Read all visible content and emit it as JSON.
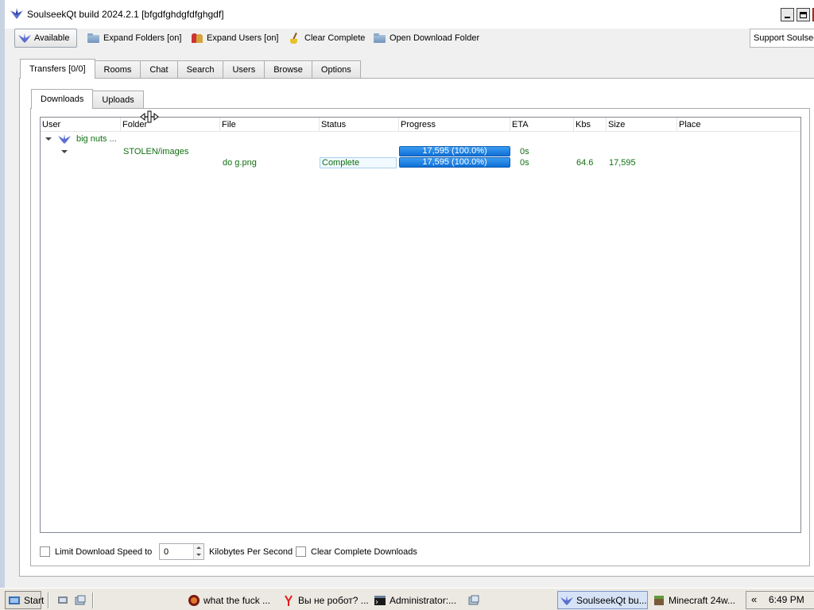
{
  "window": {
    "title": "SoulseekQt build 2024.2.1 [bfgdfghdgfdfghgdf]"
  },
  "toolbar": {
    "available": "Available",
    "expand_folders": "Expand Folders [on]",
    "expand_users": "Expand Users [on]",
    "clear_complete": "Clear Complete",
    "open_download_folder": "Open Download Folder",
    "support": "Support Soulseek"
  },
  "main_tabs": [
    "Transfers [0/0]",
    "Rooms",
    "Chat",
    "Search",
    "Users",
    "Browse",
    "Options"
  ],
  "active_main_tab": "Transfers [0/0]",
  "sub_tabs": [
    "Downloads",
    "Uploads"
  ],
  "active_sub_tab": "Downloads",
  "table": {
    "columns": [
      "User",
      "Folder",
      "File",
      "Status",
      "Progress",
      "ETA",
      "Kbs",
      "Size",
      "Place"
    ],
    "user_row": {
      "user": "big nuts ..."
    },
    "folder_row": {
      "folder": "STOLEN/images",
      "progress": "17,595 (100.0%)",
      "progress_fraction": 1.0,
      "eta": "0s"
    },
    "file_row": {
      "file": "do g.png",
      "status": "Complete",
      "progress": "17,595 (100.0%)",
      "progress_fraction": 1.0,
      "eta": "0s",
      "kbs": "64.6",
      "size": "17,595",
      "place": ""
    }
  },
  "bottom": {
    "limit_label": "Limit Download Speed to",
    "limit_checked": false,
    "limit_value": "0",
    "units_label": "Kilobytes Per Second",
    "clear_complete_label": "Clear Complete Downloads",
    "clear_complete_checked": false
  },
  "taskbar": {
    "start": "Start",
    "tasks": [
      {
        "label": "what the fuck ...",
        "icon": "browser-icon"
      },
      {
        "label": "Вы не робот? ...",
        "icon": "yandex-icon"
      },
      {
        "label": "Administrator:...",
        "icon": "console-icon"
      },
      {
        "label": "SoulseekQt bu...",
        "icon": "soulseek-icon",
        "active": true
      },
      {
        "label": "Minecraft 24w...",
        "icon": "minecraft-icon"
      }
    ],
    "clock_chevron": "«",
    "clock": "6:49 PM"
  },
  "colors": {
    "row_text": "#107010",
    "progress_fill": "#0f6fd6",
    "window_border": "#c8d3e2"
  }
}
